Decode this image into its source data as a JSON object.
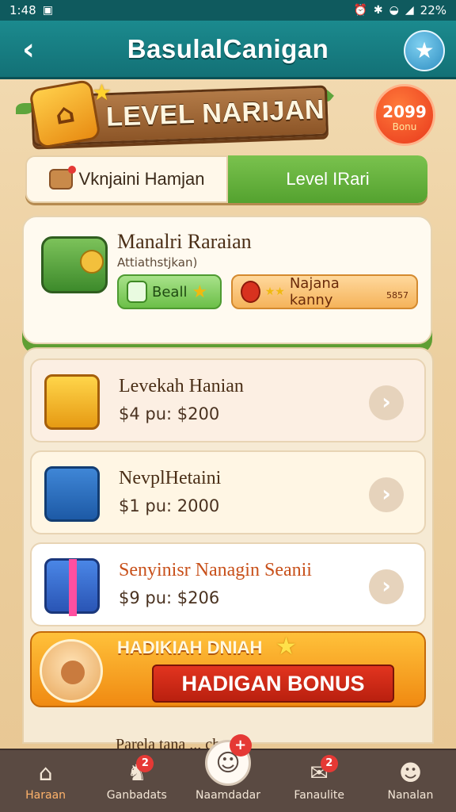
{
  "status_bar": {
    "time": "1:48",
    "battery": "22%"
  },
  "app_bar": {
    "title": "BasulalCanigan"
  },
  "banner": {
    "title": "LEVEL NARIJAN"
  },
  "corner_badge": {
    "value": "2099",
    "label": "Bonu"
  },
  "tabs": [
    {
      "label": "Vknjaini Hamjan",
      "active": false
    },
    {
      "label": "Level IRari",
      "active": true
    }
  ],
  "featured": {
    "title": "Manalri Raraian",
    "subtitle": "Attiathstjkan)",
    "green_pill": "Beall",
    "orange_pill": "Najana kanny",
    "orange_pill_small": "5857"
  },
  "offers": [
    {
      "title": "Levekah Hanian",
      "price": "$4 pu: $200"
    },
    {
      "title": "NevplHetaini",
      "price": "$1 pu: 2000"
    },
    {
      "title": "Senyinisr Nanagin Seanii",
      "price": "$9 pu: $206"
    }
  ],
  "bonus": {
    "heading": "HADIKIAH DNIAH",
    "button": "HADIGAN BONUS"
  },
  "peek_row": "Parela tana ... chan",
  "bottom_nav": [
    {
      "label": "Haraan",
      "icon": "home-icon",
      "badge": ""
    },
    {
      "label": "Ganbadats",
      "icon": "chess-icon",
      "badge": "2"
    },
    {
      "label": "Naamdadar",
      "icon": "smile-icon",
      "badge": "+"
    },
    {
      "label": "Fanaulite",
      "icon": "mail-icon",
      "badge": "2"
    },
    {
      "label": "Nanalan",
      "icon": "user-icon",
      "badge": ""
    }
  ],
  "colors": {
    "appbar": "#137176",
    "accent_green": "#54a22f",
    "accent_orange": "#f08a12",
    "nav_bg": "#5a4a42"
  }
}
